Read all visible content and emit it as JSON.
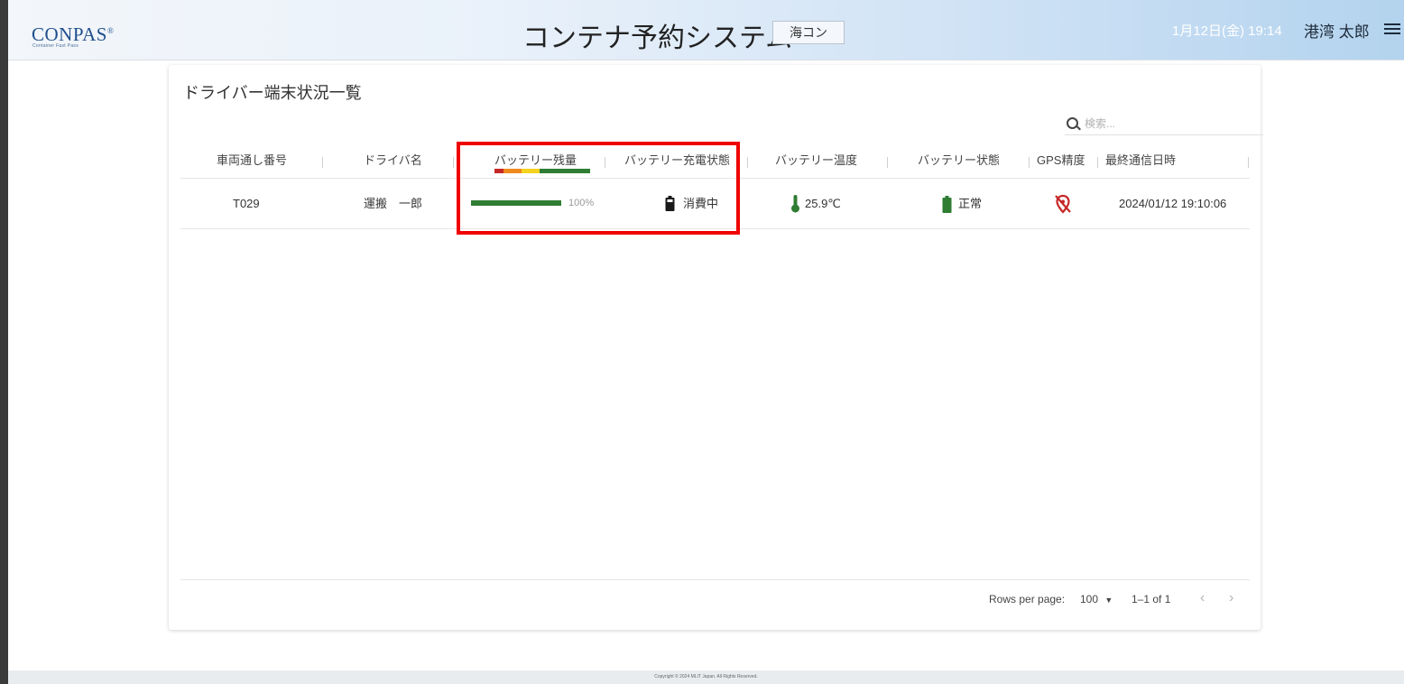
{
  "header": {
    "logo": "CONPAS",
    "logo_mark": "®",
    "logo_sub": "Container Fast Pass",
    "title": "コンテナ予約システム",
    "mode_badge": "海コン",
    "datetime": "1月12日(金) 19:14",
    "username": "港湾 太郎",
    "menu_icon": "hamburger-menu-icon"
  },
  "page": {
    "title": "ドライバー端末状況一覧",
    "search_placeholder": "検索..."
  },
  "table": {
    "columns": [
      "車両通し番号",
      "ドライバ名",
      "バッテリー残量",
      "バッテリー充電状態",
      "バッテリー温度",
      "バッテリー状態",
      "GPS精度",
      "最終通信日時"
    ],
    "battery_scale_colors": [
      "#c62828",
      "#ef8a1e",
      "#f4d21f",
      "#2e7d32"
    ],
    "rows": [
      {
        "vehicle_no": "T029",
        "driver": "運搬　一郎",
        "battery_level": 100,
        "battery_level_label": "100%",
        "charge_status": "消費中",
        "charge_icon": "battery-icon",
        "temperature": "25.9℃",
        "temperature_icon": "thermometer-icon",
        "battery_state": "正常",
        "battery_state_icon": "battery-full-icon",
        "gps_icon": "location-off-icon",
        "last_comm": "2024/01/12 19:10:06"
      }
    ]
  },
  "pagination": {
    "rows_per_page_label": "Rows per page:",
    "rows_per_page": "100",
    "range": "1–1 of 1"
  },
  "colors": {
    "accent_green": "#2e7d32",
    "highlight_red": "#f00000",
    "gps_red": "#c62828"
  },
  "footer": {
    "copyright": "Copyright © 2024 MLIT Japan. All Rights Reserved."
  }
}
